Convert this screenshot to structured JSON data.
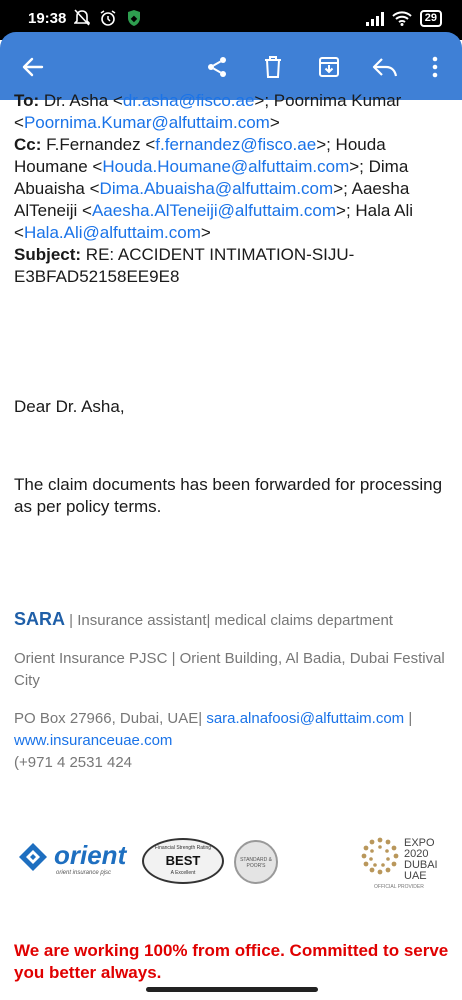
{
  "status": {
    "time": "19:38",
    "battery": "29"
  },
  "email": {
    "to_label": "To:",
    "to_text_1": " Dr. Asha <",
    "to_email_1": "dr.asha@fisco.ae",
    "to_text_2": ">; Poornima Kumar <",
    "to_email_2": "Poornima.Kumar@alfuttaim.com",
    "to_text_3": ">",
    "cc_label": "Cc:",
    "cc_text_1": " F.Fernandez <",
    "cc_email_1": "f.fernandez@fisco.ae",
    "cc_text_2": ">; Houda Houmane <",
    "cc_email_2": "Houda.Houmane@alfuttaim.com",
    "cc_text_3": ">; Dima Abuaisha <",
    "cc_email_3": "Dima.Abuaisha@alfuttaim.com",
    "cc_text_4": ">; Aaesha AlTeneiji <",
    "cc_email_4": "Aaesha.AlTeneiji@alfuttaim.com",
    "cc_text_5": ">; Hala Ali <",
    "cc_email_5": "Hala.Ali@alfuttaim.com",
    "cc_text_6": ">",
    "subject_label": "Subject:",
    "subject_text": " RE: ACCIDENT INTIMATION-SIJU-E3BFAD52158EE9E8",
    "greeting": "Dear Dr. Asha,",
    "body": "The claim documents has been forwarded for processing as per policy terms."
  },
  "signature": {
    "name": "SARA",
    "role": " | Insurance assistant| medical claims department",
    "company": "Orient Insurance PJSC | Orient Building, Al Badia, Dubai Festival City",
    "po_box": "PO Box 27966, Dubai, UAE| ",
    "email": "sara.alnafoosi@alfuttaim.com",
    "sep": " |",
    "website": "www.insuranceuae.com",
    "phone": "(+971 4 2531 424"
  },
  "logos": {
    "orient": "orient",
    "orient_sub": "orient insurance pjsc",
    "ambest": "BEST",
    "ambest_top": "Financial Strength Rating",
    "ambest_bottom": "A Excellent",
    "sp": "STANDARD & POOR'S",
    "expo_1": "EXPO",
    "expo_2": "2020",
    "expo_3": "DUBAI",
    "expo_4": "UAE",
    "expo_sub": "OFFICIAL PROVIDER"
  },
  "banner": "We are working 100% from office.  Committed to serve you better always.",
  "colors": {
    "appbar": "#3f80d6",
    "link": "#1a73e8",
    "banner": "#e00000"
  }
}
